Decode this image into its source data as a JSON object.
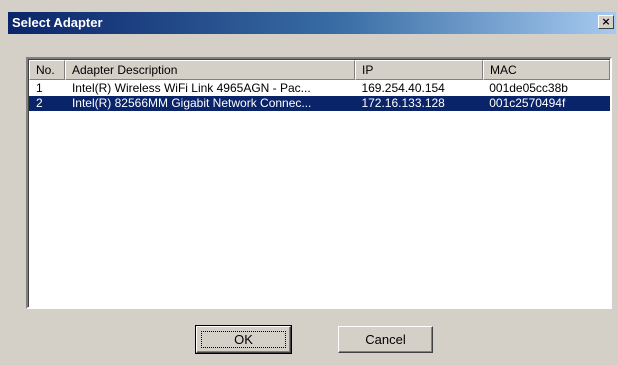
{
  "window": {
    "title": "Select Adapter",
    "close_glyph": "×"
  },
  "table": {
    "columns": [
      {
        "key": "no",
        "label": "No."
      },
      {
        "key": "description",
        "label": "Adapter Description"
      },
      {
        "key": "ip",
        "label": "IP"
      },
      {
        "key": "mac",
        "label": "MAC"
      }
    ],
    "rows": [
      {
        "no": "1",
        "description": "Intel(R) Wireless WiFi Link 4965AGN - Pac...",
        "ip": "169.254.40.154",
        "mac": "001de05cc38b",
        "selected": false
      },
      {
        "no": "2",
        "description": "Intel(R) 82566MM Gigabit Network Connec...",
        "ip": "172.16.133.128",
        "mac": "001c2570494f",
        "selected": true
      }
    ]
  },
  "buttons": {
    "ok_label": "OK",
    "cancel_label": "Cancel"
  },
  "colors": {
    "selection": "#0a246a",
    "face": "#d4d0c8",
    "title_start": "#0a246a",
    "title_end": "#a6caf0"
  }
}
